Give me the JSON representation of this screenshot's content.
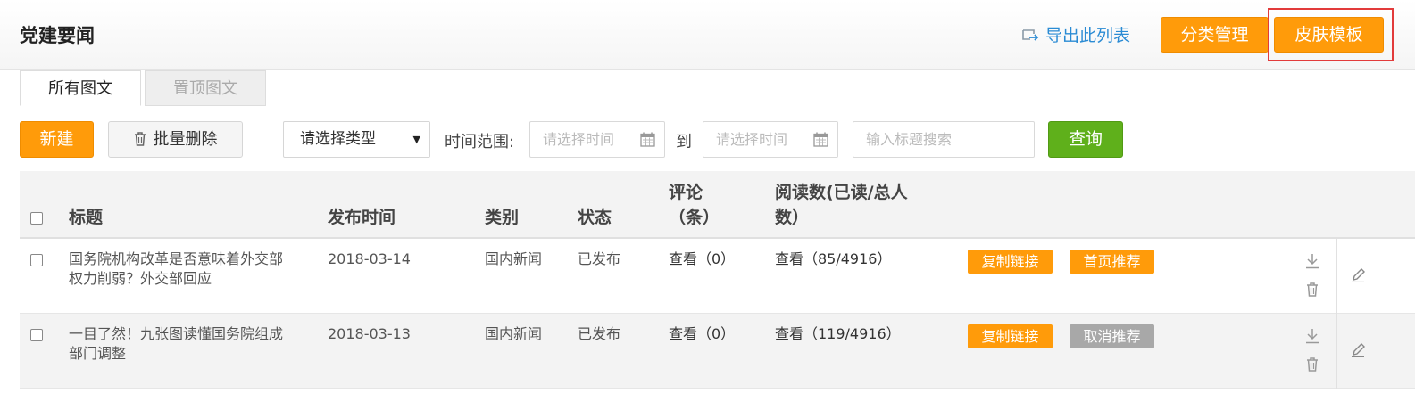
{
  "header": {
    "title": "党建要闻",
    "export_label": "导出此列表",
    "category_btn": "分类管理",
    "skin_btn": "皮肤模板"
  },
  "tabs": [
    {
      "label": "所有图文",
      "active": true
    },
    {
      "label": "置顶图文",
      "active": false
    }
  ],
  "toolbar": {
    "new_btn": "新建",
    "batch_delete_btn": "批量删除",
    "type_select": "请选择类型",
    "time_range_label": "时间范围:",
    "start_placeholder": "请选择时间",
    "to_label": "到",
    "end_placeholder": "请选择时间",
    "search_placeholder": "输入标题搜索",
    "query_btn": "查询"
  },
  "table": {
    "headers": {
      "title": "标题",
      "publish_time": "发布时间",
      "category": "类别",
      "status": "状态",
      "comments_line1": "评论",
      "comments_line2": "（条）",
      "reads_line1": "阅读数(已读/总人",
      "reads_line2": "数）"
    },
    "rows": [
      {
        "title_line1": "国务院机构改革是否意味着外交部",
        "title_line2": "权力削弱？外交部回应",
        "date": "2018-03-14",
        "category": "国内新闻",
        "status": "已发布",
        "comments": "查看（0）",
        "reads": "查看（85/4916）",
        "copy_link": "复制链接",
        "recommend": "首页推荐",
        "recommend_style": "orange"
      },
      {
        "title_line1": "一目了然！九张图读懂国务院组成",
        "title_line2": "部门调整",
        "date": "2018-03-13",
        "category": "国内新闻",
        "status": "已发布",
        "comments": "查看（0）",
        "reads": "查看（119/4916）",
        "copy_link": "复制链接",
        "recommend": "取消推荐",
        "recommend_style": "gray"
      }
    ]
  },
  "colors": {
    "orange": "#ff9b0a",
    "green": "#5fb01b",
    "link_blue": "#2a8bd4",
    "highlight_red": "#e23b3b",
    "tag_gray": "#a8a8a8"
  }
}
